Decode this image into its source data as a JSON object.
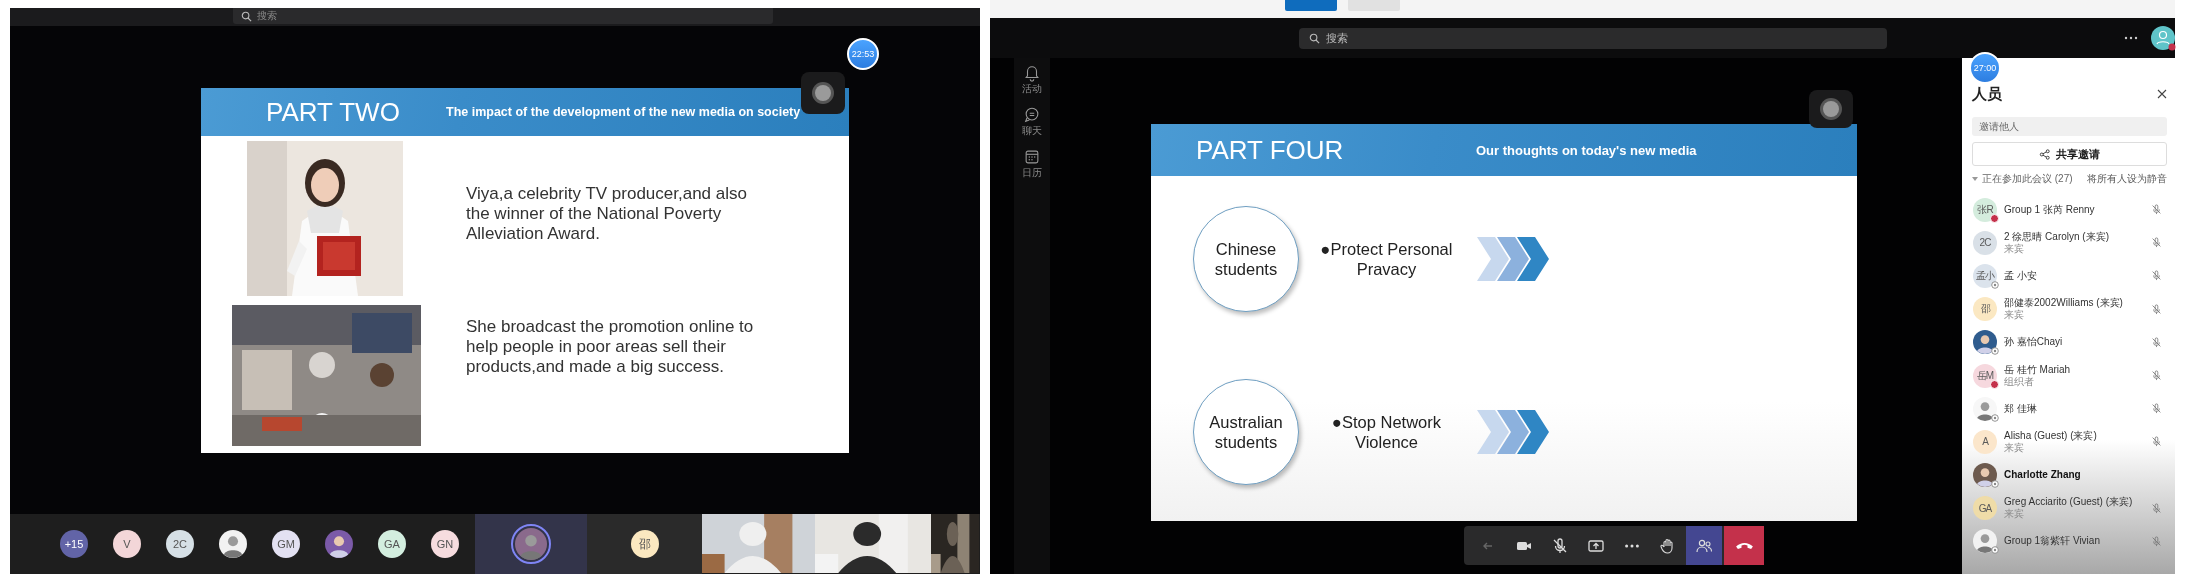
{
  "left_window": {
    "search": {
      "placeholder": "搜索"
    },
    "timer": "22:53",
    "slide": {
      "title": "PART TWO",
      "subtitle": "The impact of the development of the new media on society",
      "items": [
        {
          "kind": "picture",
          "text": "Viya,a celebrity TV producer,and also the winner of the National Poverty Alleviation Award."
        },
        {
          "kind": "picture",
          "text": "She broadcast the promotion online to help people in poor areas sell their products,and made a big success."
        }
      ]
    },
    "participants": [
      {
        "kind": "count",
        "label": "+15",
        "color": "#6264a7"
      },
      {
        "kind": "initials",
        "label": "V",
        "color": "#f3d6d8"
      },
      {
        "kind": "initials",
        "label": "2C",
        "color": "#d6e0e6"
      },
      {
        "kind": "picture"
      },
      {
        "kind": "initials",
        "label": "GM",
        "color": "#e3e1f2"
      },
      {
        "kind": "picture"
      },
      {
        "kind": "initials",
        "label": "GA",
        "color": "#d3eedf"
      },
      {
        "kind": "initials",
        "label": "GN",
        "color": "#f6dcdf"
      }
    ],
    "tiles": [
      {
        "kind": "picture",
        "selected": true
      },
      {
        "kind": "initials",
        "label": "邵",
        "color": "#fbe8c0",
        "selected": false
      }
    ]
  },
  "right_window": {
    "search": {
      "placeholder": "搜索"
    },
    "rail": [
      {
        "kind": "bell",
        "label": "活动"
      },
      {
        "kind": "chat",
        "label": "聊天"
      },
      {
        "kind": "calendar",
        "label": "日历"
      }
    ],
    "slide": {
      "title": "PART FOUR",
      "subtitle": "Our thoughts on today's new media",
      "rows": [
        {
          "group": "Chinese students",
          "point": "●Protect Personal Pravacy"
        },
        {
          "group": "Australian students",
          "point": "●Stop Network Violence"
        }
      ]
    },
    "toolbar": [
      {
        "kind": "back",
        "selected": false
      },
      {
        "kind": "camera",
        "selected": false
      },
      {
        "kind": "mic-off",
        "selected": false
      },
      {
        "kind": "share",
        "selected": false
      },
      {
        "kind": "more",
        "selected": false
      },
      {
        "kind": "hand",
        "selected": false
      },
      {
        "kind": "people",
        "selected": true
      },
      {
        "kind": "hangup",
        "selected": false
      }
    ],
    "timer": "27:00",
    "people_panel": {
      "title": "人员",
      "invite": {
        "placeholder": "邀请他人"
      },
      "share_button": "共享邀请",
      "section": {
        "label": "正在参加此会议 (27)",
        "expanded": true
      },
      "mute_all": "将所有人设为静音",
      "people": [
        {
          "name": "Group 1 张芮 Renny",
          "avatar": {
            "kind": "initials",
            "label": "张R",
            "color": "#d4ecdd"
          },
          "busy": true,
          "status_ring": false,
          "self": false,
          "muted": true
        },
        {
          "name": "2 徐思晴 Carolyn (来宾)",
          "note": "来宾",
          "avatar": {
            "kind": "initials",
            "label": "2C",
            "color": "#d9e0e7"
          },
          "busy": false,
          "status_ring": false,
          "self": false,
          "muted": true
        },
        {
          "name": "孟 小安",
          "avatar": {
            "kind": "initials",
            "label": "孟小",
            "color": "#dbe3ec"
          },
          "busy": false,
          "status_ring": true,
          "self": false,
          "muted": true
        },
        {
          "name": "邵健泰2002Williams (来宾)",
          "note": "来宾",
          "avatar": {
            "kind": "initials",
            "label": "邵",
            "color": "#fbe8c2"
          },
          "busy": false,
          "status_ring": false,
          "self": false,
          "muted": true
        },
        {
          "name": "孙 嘉怡Chayi",
          "avatar": {
            "kind": "picture"
          },
          "busy": false,
          "status_ring": true,
          "self": false,
          "muted": true
        },
        {
          "name": "岳 桂竹 Mariah",
          "note": "组织者",
          "avatar": {
            "kind": "initials",
            "label": "岳M",
            "color": "#f6d8de"
          },
          "busy": true,
          "status_ring": false,
          "self": false,
          "muted": true
        },
        {
          "name": "郑 佳琳",
          "avatar": {
            "kind": "picture"
          },
          "busy": false,
          "status_ring": true,
          "self": false,
          "muted": true
        },
        {
          "name": "Alisha (Guest) (来宾)",
          "note": "来宾",
          "avatar": {
            "kind": "initials",
            "label": "A",
            "color": "#fbe6cb"
          },
          "busy": false,
          "status_ring": false,
          "self": false,
          "muted": true
        },
        {
          "name": "Charlotte Zhang",
          "avatar": {
            "kind": "picture"
          },
          "busy": false,
          "status_ring": true,
          "self": true
        },
        {
          "name": "Greg Acciarito (Guest) (来宾)",
          "note": "来宾",
          "avatar": {
            "kind": "initials",
            "label": "GA",
            "color": "#efdca8"
          },
          "busy": false,
          "status_ring": false,
          "self": false,
          "muted": true
        },
        {
          "name": "Group 1翁紫轩 Vivian",
          "avatar": {
            "kind": "picture"
          },
          "busy": false,
          "status_ring": true,
          "self": false,
          "muted": true
        }
      ]
    }
  }
}
